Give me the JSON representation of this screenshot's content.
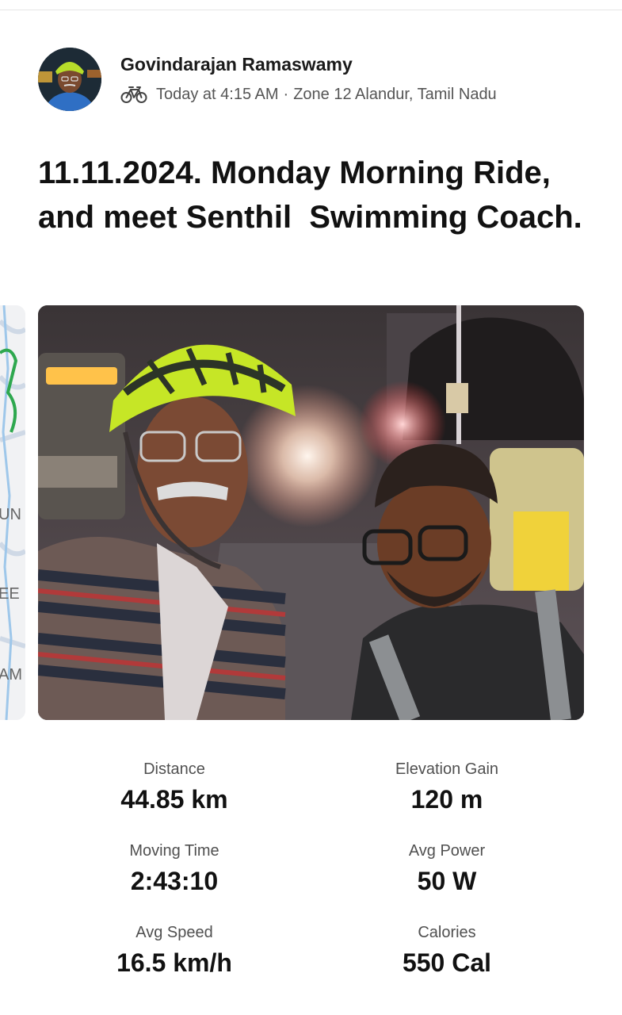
{
  "post": {
    "author": "Govindarajan Ramaswamy",
    "activity_icon": "bike-icon",
    "time": "Today at 4:15 AM",
    "separator": "·",
    "location": "Zone 12 Alandur, Tamil Nadu",
    "title": "11.11.2024. Monday Morning Ride, and meet Senthil  Swimming Coach."
  },
  "map_peek": {
    "labels": [
      "UN",
      "EE",
      "AM"
    ]
  },
  "stats": [
    {
      "label": "Distance",
      "value": "44.85 km"
    },
    {
      "label": "Elevation Gain",
      "value": "120 m"
    },
    {
      "label": "Moving Time",
      "value": "2:43:10"
    },
    {
      "label": "Avg Power",
      "value": "50 W"
    },
    {
      "label": "Avg Speed",
      "value": "16.5 km/h"
    },
    {
      "label": "Calories",
      "value": "550 Cal"
    }
  ],
  "colors": {
    "text_primary": "#111111",
    "text_secondary": "#555555",
    "helmet": "#c6e626",
    "route": "#2ea84f"
  }
}
